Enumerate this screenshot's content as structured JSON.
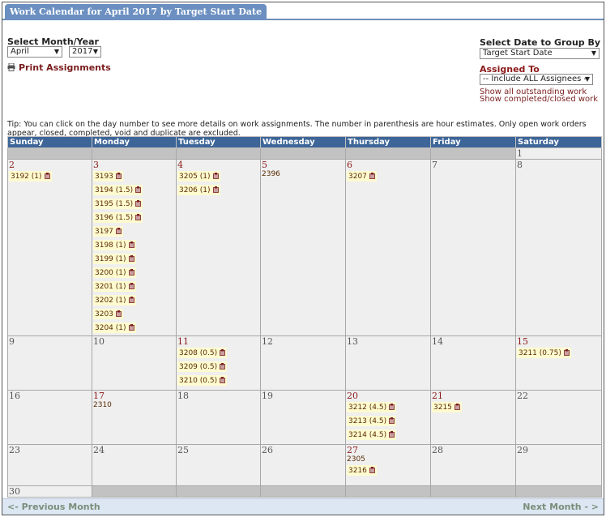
{
  "header": {
    "tab_title": "Work Calendar for April  2017 by Target Start Date"
  },
  "controls": {
    "month_year_label": "Select Month/Year",
    "month_value": "April",
    "year_value": "2017",
    "print_label": "Print Assignments",
    "group_by_label": "Select Date to Group By",
    "group_by_value": "Target Start Date",
    "assigned_label": "Assigned To",
    "assigned_value": "-- Include ALL Assignees --",
    "show_outstanding": "Show all outstanding work",
    "show_completed": "Show completed/closed work"
  },
  "tip": "Tip: You can click on the day number to see more details on work assignments. The number in parenthesis are hour estimates. Only open work orders appear, closed, completed, void and duplicate are excluded.",
  "calendar": {
    "weekdays": [
      "Sunday",
      "Monday",
      "Tuesday",
      "Wednesday",
      "Thursday",
      "Friday",
      "Saturday"
    ],
    "weeks": [
      [
        null,
        null,
        null,
        null,
        null,
        null,
        {
          "day": "1",
          "items": []
        }
      ],
      [
        {
          "day": "2",
          "items": [
            {
              "label": "3192 (1)",
              "icon": true
            }
          ]
        },
        {
          "day": "3",
          "items": [
            {
              "label": "3193",
              "icon": true
            },
            {
              "label": "3194 (1.5)",
              "icon": true
            },
            {
              "label": "3195 (1.5)",
              "icon": true
            },
            {
              "label": "3196 (1.5)",
              "icon": true
            },
            {
              "label": "3197",
              "icon": true
            },
            {
              "label": "3198 (1)",
              "icon": true
            },
            {
              "label": "3199 (1)",
              "icon": true
            },
            {
              "label": "3200 (1)",
              "icon": true
            },
            {
              "label": "3201 (1)",
              "icon": true
            },
            {
              "label": "3202 (1)",
              "icon": true
            },
            {
              "label": "3203",
              "icon": true
            },
            {
              "label": "3204 (1)",
              "icon": true
            }
          ]
        },
        {
          "day": "4",
          "items": [
            {
              "label": "3205 (1)",
              "icon": true
            },
            {
              "label": "3206 (1)",
              "icon": true
            }
          ]
        },
        {
          "day": "5",
          "items": [
            {
              "label": "2396",
              "icon": false
            }
          ]
        },
        {
          "day": "6",
          "items": [
            {
              "label": "3207",
              "icon": true
            }
          ]
        },
        {
          "day": "7",
          "items": []
        },
        {
          "day": "8",
          "items": []
        }
      ],
      [
        {
          "day": "9",
          "items": []
        },
        {
          "day": "10",
          "items": []
        },
        {
          "day": "11",
          "items": [
            {
              "label": "3208 (0.5)",
              "icon": true
            },
            {
              "label": "3209 (0.5)",
              "icon": true
            },
            {
              "label": "3210 (0.5)",
              "icon": true
            }
          ]
        },
        {
          "day": "12",
          "items": []
        },
        {
          "day": "13",
          "items": []
        },
        {
          "day": "14",
          "items": []
        },
        {
          "day": "15",
          "items": [
            {
              "label": "3211 (0.75)",
              "icon": true
            }
          ]
        }
      ],
      [
        {
          "day": "16",
          "items": []
        },
        {
          "day": "17",
          "items": [
            {
              "label": "2310",
              "icon": false
            }
          ]
        },
        {
          "day": "18",
          "items": []
        },
        {
          "day": "19",
          "items": []
        },
        {
          "day": "20",
          "items": [
            {
              "label": "3212 (4.5)",
              "icon": true
            },
            {
              "label": "3213 (4.5)",
              "icon": true
            },
            {
              "label": "3214 (4.5)",
              "icon": true
            }
          ]
        },
        {
          "day": "21",
          "items": [
            {
              "label": "3215",
              "icon": true
            }
          ]
        },
        {
          "day": "22",
          "items": []
        }
      ],
      [
        {
          "day": "23",
          "items": []
        },
        {
          "day": "24",
          "items": []
        },
        {
          "day": "25",
          "items": []
        },
        {
          "day": "26",
          "items": []
        },
        {
          "day": "27",
          "items": [
            {
              "label": "2305",
              "icon": false
            },
            {
              "label": "3216",
              "icon": true
            }
          ]
        },
        {
          "day": "28",
          "items": []
        },
        {
          "day": "29",
          "items": []
        }
      ],
      [
        {
          "day": "30",
          "items": []
        },
        null,
        null,
        null,
        null,
        null,
        null
      ]
    ]
  },
  "footer": {
    "prev_label": "<- Previous Month",
    "next_label": "Next Month - >"
  }
}
